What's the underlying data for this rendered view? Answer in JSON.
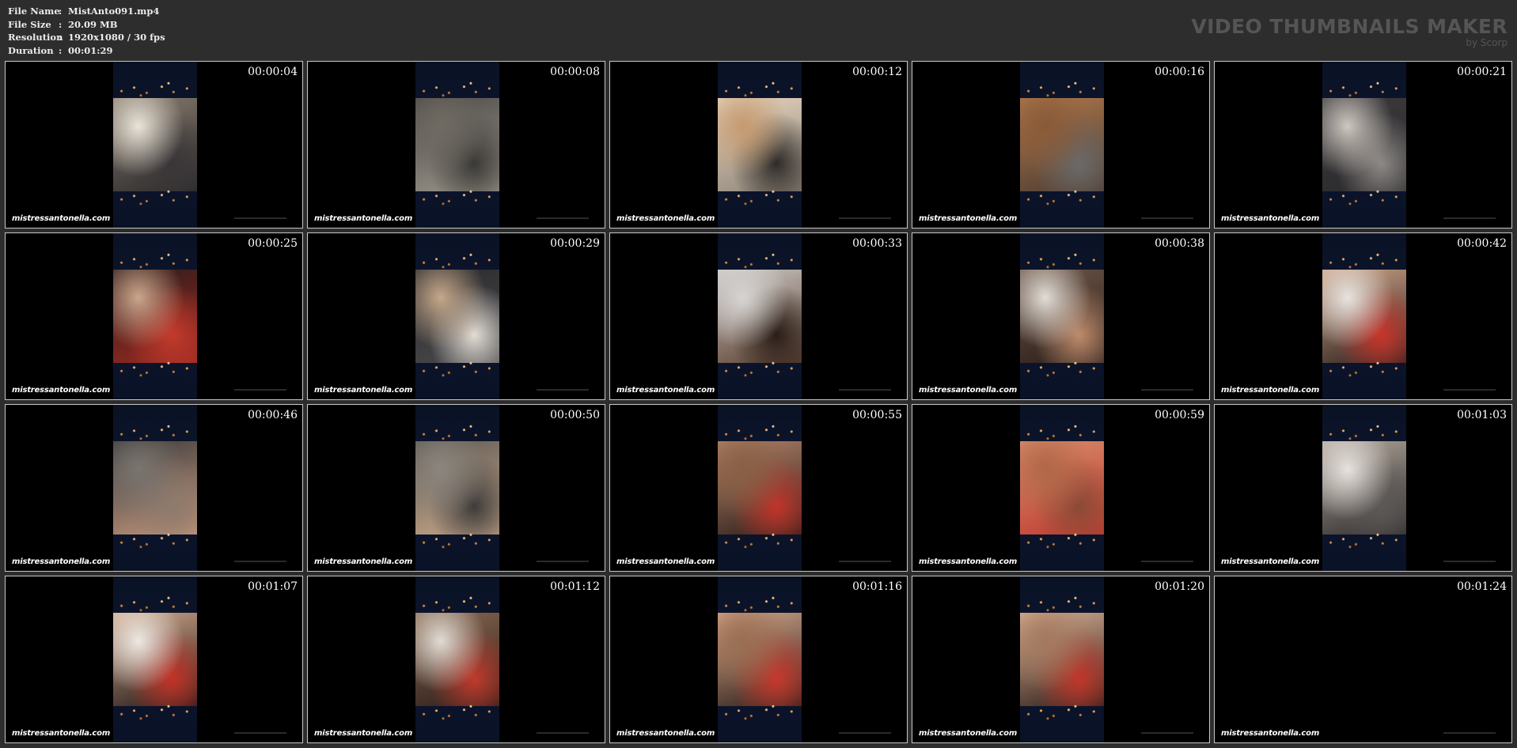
{
  "file_info": {
    "rows": [
      {
        "key": "File Name",
        "value": "MistAnto091.mp4"
      },
      {
        "key": "File Size",
        "value": "20.09 MB"
      },
      {
        "key": "Resolution",
        "value": "1920x1080 / 30 fps"
      },
      {
        "key": "Duration",
        "value": "00:01:29"
      }
    ],
    "separator": ":"
  },
  "brand": {
    "title": "VIDEO THUMBNAILS MAKER",
    "subtitle": "by Scorp"
  },
  "watermark": "mistressantonella.com",
  "thumbnails": [
    {
      "timestamp": "00:00:04",
      "colors": [
        "#e9e3d8",
        "#8a7d6e",
        "#2b2a2c",
        "#3a3638"
      ]
    },
    {
      "timestamp": "00:00:08",
      "colors": [
        "#6f6a62",
        "#4d4a47",
        "#9c968c",
        "#3b3937"
      ]
    },
    {
      "timestamp": "00:00:12",
      "colors": [
        "#c69a6e",
        "#e9d6c0",
        "#8b8378",
        "#2f2b28"
      ]
    },
    {
      "timestamp": "00:00:16",
      "colors": [
        "#8a5a38",
        "#b07a4c",
        "#4a3a32",
        "#6a6a6a"
      ]
    },
    {
      "timestamp": "00:00:21",
      "colors": [
        "#cfc8c0",
        "#3c3a3d",
        "#2a292c",
        "#8f8a86"
      ]
    },
    {
      "timestamp": "00:00:25",
      "colors": [
        "#caa68c",
        "#2a1c1a",
        "#9c2a22",
        "#c43a2c"
      ]
    },
    {
      "timestamp": "00:00:29",
      "colors": [
        "#c6a88a",
        "#2a2a2c",
        "#4a4a4d",
        "#e2dcd4"
      ]
    },
    {
      "timestamp": "00:00:33",
      "colors": [
        "#d6d4d2",
        "#cfccc9",
        "#5a3e2e",
        "#2a1e18"
      ]
    },
    {
      "timestamp": "00:00:38",
      "colors": [
        "#e2ddd7",
        "#6d5646",
        "#2a1d1a",
        "#bf8c6c"
      ]
    },
    {
      "timestamp": "00:00:42",
      "colors": [
        "#e6e3df",
        "#cfa487",
        "#2b1f1d",
        "#c8342a"
      ]
    },
    {
      "timestamp": "00:00:46",
      "colors": [
        "#7a7570",
        "#3a3a3c",
        "#c4977c",
        "#8e7a6c"
      ]
    },
    {
      "timestamp": "00:00:50",
      "colors": [
        "#8a857e",
        "#5e5a55",
        "#c9a88a",
        "#3e3c3b"
      ]
    },
    {
      "timestamp": "00:00:55",
      "colors": [
        "#8a6044",
        "#b4846a",
        "#2a1c18",
        "#c2342a"
      ]
    },
    {
      "timestamp": "00:00:59",
      "colors": [
        "#b06848",
        "#d98e6c",
        "#c03a30",
        "#8a4a36"
      ]
    },
    {
      "timestamp": "00:01:03",
      "colors": [
        "#e6e2de",
        "#b4a89c",
        "#2d2b2d",
        "#5c5855"
      ]
    },
    {
      "timestamp": "00:01:07",
      "colors": [
        "#ece8e2",
        "#d3a98e",
        "#221816",
        "#c33226"
      ]
    },
    {
      "timestamp": "00:01:12",
      "colors": [
        "#e2dcd4",
        "#8a6a52",
        "#2a1c18",
        "#c03a2c"
      ]
    },
    {
      "timestamp": "00:01:16",
      "colors": [
        "#9a6e50",
        "#d6a88c",
        "#2a1c18",
        "#c8382c"
      ]
    },
    {
      "timestamp": "00:01:20",
      "colors": [
        "#a47a5e",
        "#dcb296",
        "#2a1c18",
        "#c2362a"
      ]
    },
    {
      "timestamp": "00:01:24",
      "colors": []
    }
  ]
}
